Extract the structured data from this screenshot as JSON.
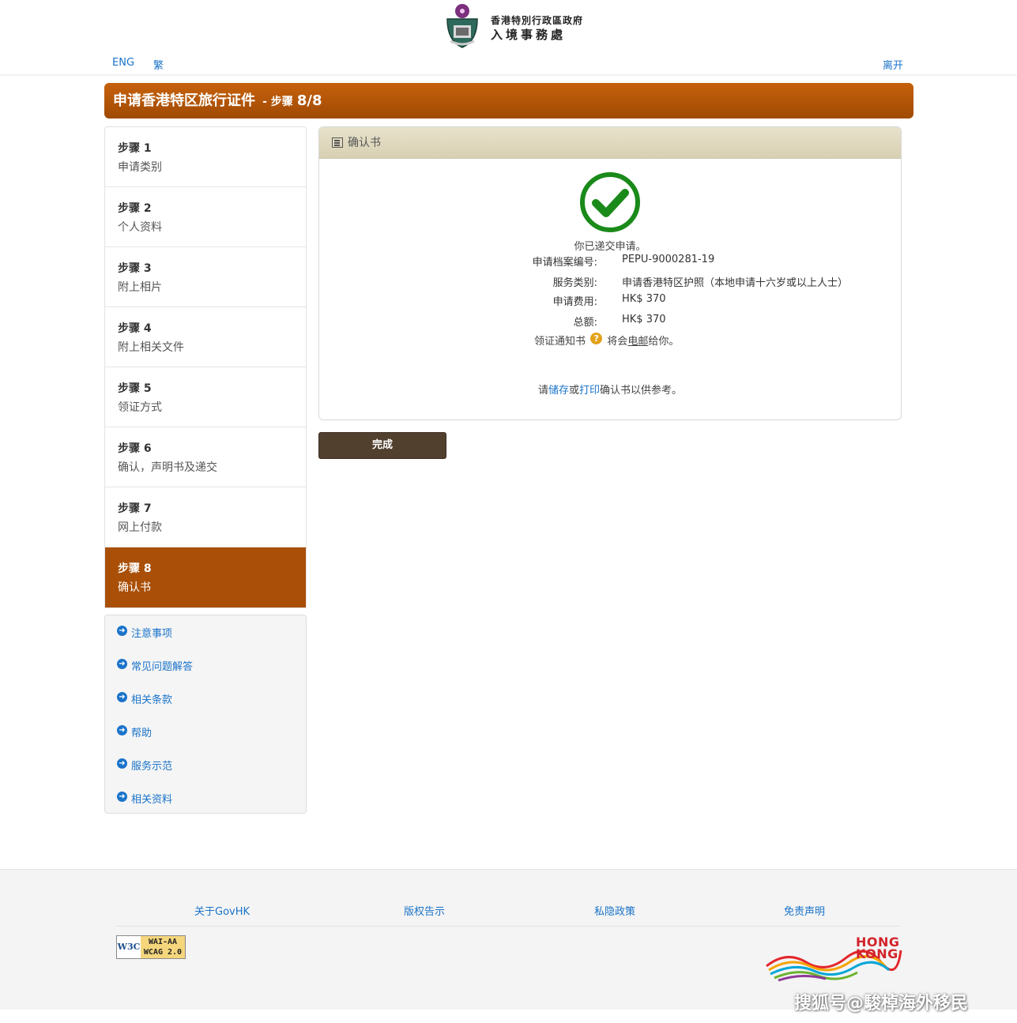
{
  "header": {
    "dept_line1": "香港特別行政區政府",
    "dept_line2": "入境事務處",
    "lang_eng": "ENG",
    "lang_trad": "繁",
    "exit": "离开"
  },
  "title": {
    "main": "申请香港特区旅行证件",
    "sep": "- 步骤",
    "step": "8/8"
  },
  "steps": [
    {
      "num": "步骤 1",
      "label": "申请类别"
    },
    {
      "num": "步骤 2",
      "label": "个人资料"
    },
    {
      "num": "步骤 3",
      "label": "附上相片"
    },
    {
      "num": "步骤 4",
      "label": "附上相关文件"
    },
    {
      "num": "步骤 5",
      "label": "领证方式"
    },
    {
      "num": "步骤 6",
      "label": "确认，声明书及递交"
    },
    {
      "num": "步骤 7",
      "label": "网上付款"
    },
    {
      "num": "步骤 8",
      "label": "确认书"
    }
  ],
  "info_links": [
    "注意事项",
    "常见问题解答",
    "相关条款",
    "帮助",
    "服务示范",
    "相关资料"
  ],
  "panel": {
    "heading": "确认书",
    "success": "你已递交申请。",
    "details": [
      {
        "label": "申请档案编号:",
        "value": "PEPU-9000281-19"
      },
      {
        "label": "服务类别:",
        "value": "申请香港特区护照（本地申请十六岁或以上人士）"
      },
      {
        "label": "申请费用:",
        "value": "HK$ 370"
      },
      {
        "label": "总额:",
        "value": "HK$ 370"
      }
    ],
    "notice_pre": "领证通知书",
    "notice_mid": "将会",
    "notice_email": "电邮",
    "notice_post": "给你。",
    "save_pre": "请",
    "save_link": "储存",
    "save_or": "或",
    "print_link": "打印",
    "save_post": "确认书以供参考。"
  },
  "done_button": "完成",
  "footer": {
    "links": [
      "关于GovHK",
      "版权告示",
      "私隐政策",
      "免责声明"
    ],
    "w3c_left": "W3C",
    "w3c_right1": "WAI-AA",
    "w3c_right2": "WCAG 2.0",
    "hk_line1": "HONG",
    "hk_line2": "KONG"
  },
  "watermark": "搜狐号@駿棹海外移民",
  "colors": {
    "accent": "#a94f07",
    "link": "#1a73c9",
    "success": "#1a8a1a",
    "button": "#52402f"
  }
}
